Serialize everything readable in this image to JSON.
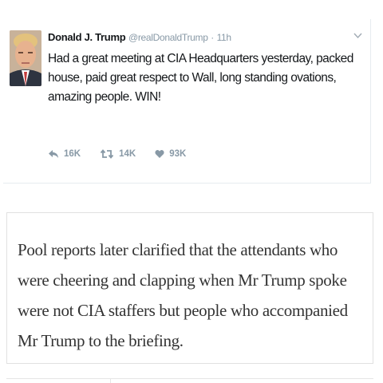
{
  "tweet": {
    "display_name": "Donald J. Trump",
    "handle": "@realDonaldTrump",
    "separator": "·",
    "timestamp": "11h",
    "text": "Had a great meeting at CIA Headquarters yesterday, packed house, paid great respect to Wall, long standing ovations, amazing people. WIN!",
    "caret_icon": "chevron-down-icon",
    "actions": {
      "reply_count": "16K",
      "retweet_count": "14K",
      "like_count": "93K"
    },
    "colors": {
      "text": "#14171a",
      "muted": "#8899a6"
    }
  },
  "article": {
    "text": "Pool reports later clarified that the attendants who were cheering and clapping when Mr Trump spoke were not CIA staffers but people who accompanied Mr Trump to the briefing."
  }
}
